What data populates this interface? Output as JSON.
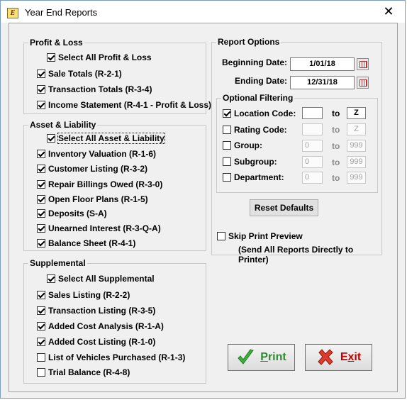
{
  "window": {
    "title": "Year End Reports",
    "icon": "app-logo-icon",
    "close_glyph": "✕"
  },
  "profit_loss": {
    "title": "Profit & Loss",
    "items": [
      {
        "label": "Select All Profit & Loss",
        "checked": true
      },
      {
        "label": "Sale Totals (R-2-1)",
        "checked": true
      },
      {
        "label": "Transaction Totals (R-3-4)",
        "checked": true
      },
      {
        "label": "Income Statement (R-4-1 - Profit & Loss)",
        "checked": true
      }
    ]
  },
  "asset_liability": {
    "title": "Asset & Liability",
    "items": [
      {
        "label": "Select All Asset & Liability",
        "checked": true
      },
      {
        "label": "Inventory Valuation (R-1-6)",
        "checked": true
      },
      {
        "label": "Customer Listing (R-3-2)",
        "checked": true
      },
      {
        "label": "Repair Billings Owed (R-3-0)",
        "checked": true
      },
      {
        "label": "Open Floor Plans (R-1-5)",
        "checked": true
      },
      {
        "label": "Deposits (S-A)",
        "checked": true
      },
      {
        "label": "Unearned Interest (R-3-Q-A)",
        "checked": true
      },
      {
        "label": "Balance Sheet (R-4-1)",
        "checked": true
      }
    ]
  },
  "supplemental": {
    "title": "Supplemental",
    "items": [
      {
        "label": "Select All Supplemental",
        "checked": true
      },
      {
        "label": "Sales Listing (R-2-2)",
        "checked": true
      },
      {
        "label": "Transaction Listing (R-3-5)",
        "checked": true
      },
      {
        "label": "Added Cost Analysis (R-1-A)",
        "checked": true
      },
      {
        "label": "Added Cost Listing (R-1-0)",
        "checked": true
      },
      {
        "label": "List of Vehicles Purchased (R-1-3)",
        "checked": false
      },
      {
        "label": "Trial Balance (R-4-8)",
        "checked": false
      }
    ]
  },
  "report_options": {
    "title": "Report Options",
    "beginning_date_label": "Beginning Date:",
    "beginning_date": "1/01/18",
    "ending_date_label": "Ending Date:",
    "ending_date": "12/31/18",
    "calendar_icon": "calendar-icon"
  },
  "optional_filtering": {
    "title": "Optional Filtering",
    "to_label": "to",
    "rows": [
      {
        "label": "Location Code:",
        "checked": true,
        "from": "",
        "to": "Z",
        "enabled": true
      },
      {
        "label": "Rating Code:",
        "checked": false,
        "from": "",
        "to": "Z",
        "enabled": false
      },
      {
        "label": "Group:",
        "checked": false,
        "from": "0",
        "to": "999",
        "enabled": false
      },
      {
        "label": "Subgroup:",
        "checked": false,
        "from": "0",
        "to": "999",
        "enabled": false
      },
      {
        "label": "Department:",
        "checked": false,
        "from": "0",
        "to": "999",
        "enabled": false
      }
    ]
  },
  "reset_defaults_label": "Reset Defaults",
  "skip_preview": {
    "label": "Skip Print Preview",
    "checked": false,
    "note": "(Send All Reports Directly to Printer)"
  },
  "print_button": {
    "label": "Print",
    "icon": "green-check-icon",
    "color": "#2e8b2e"
  },
  "exit_button": {
    "label": "Exit",
    "icon": "red-x-icon",
    "color": "#c00000"
  }
}
